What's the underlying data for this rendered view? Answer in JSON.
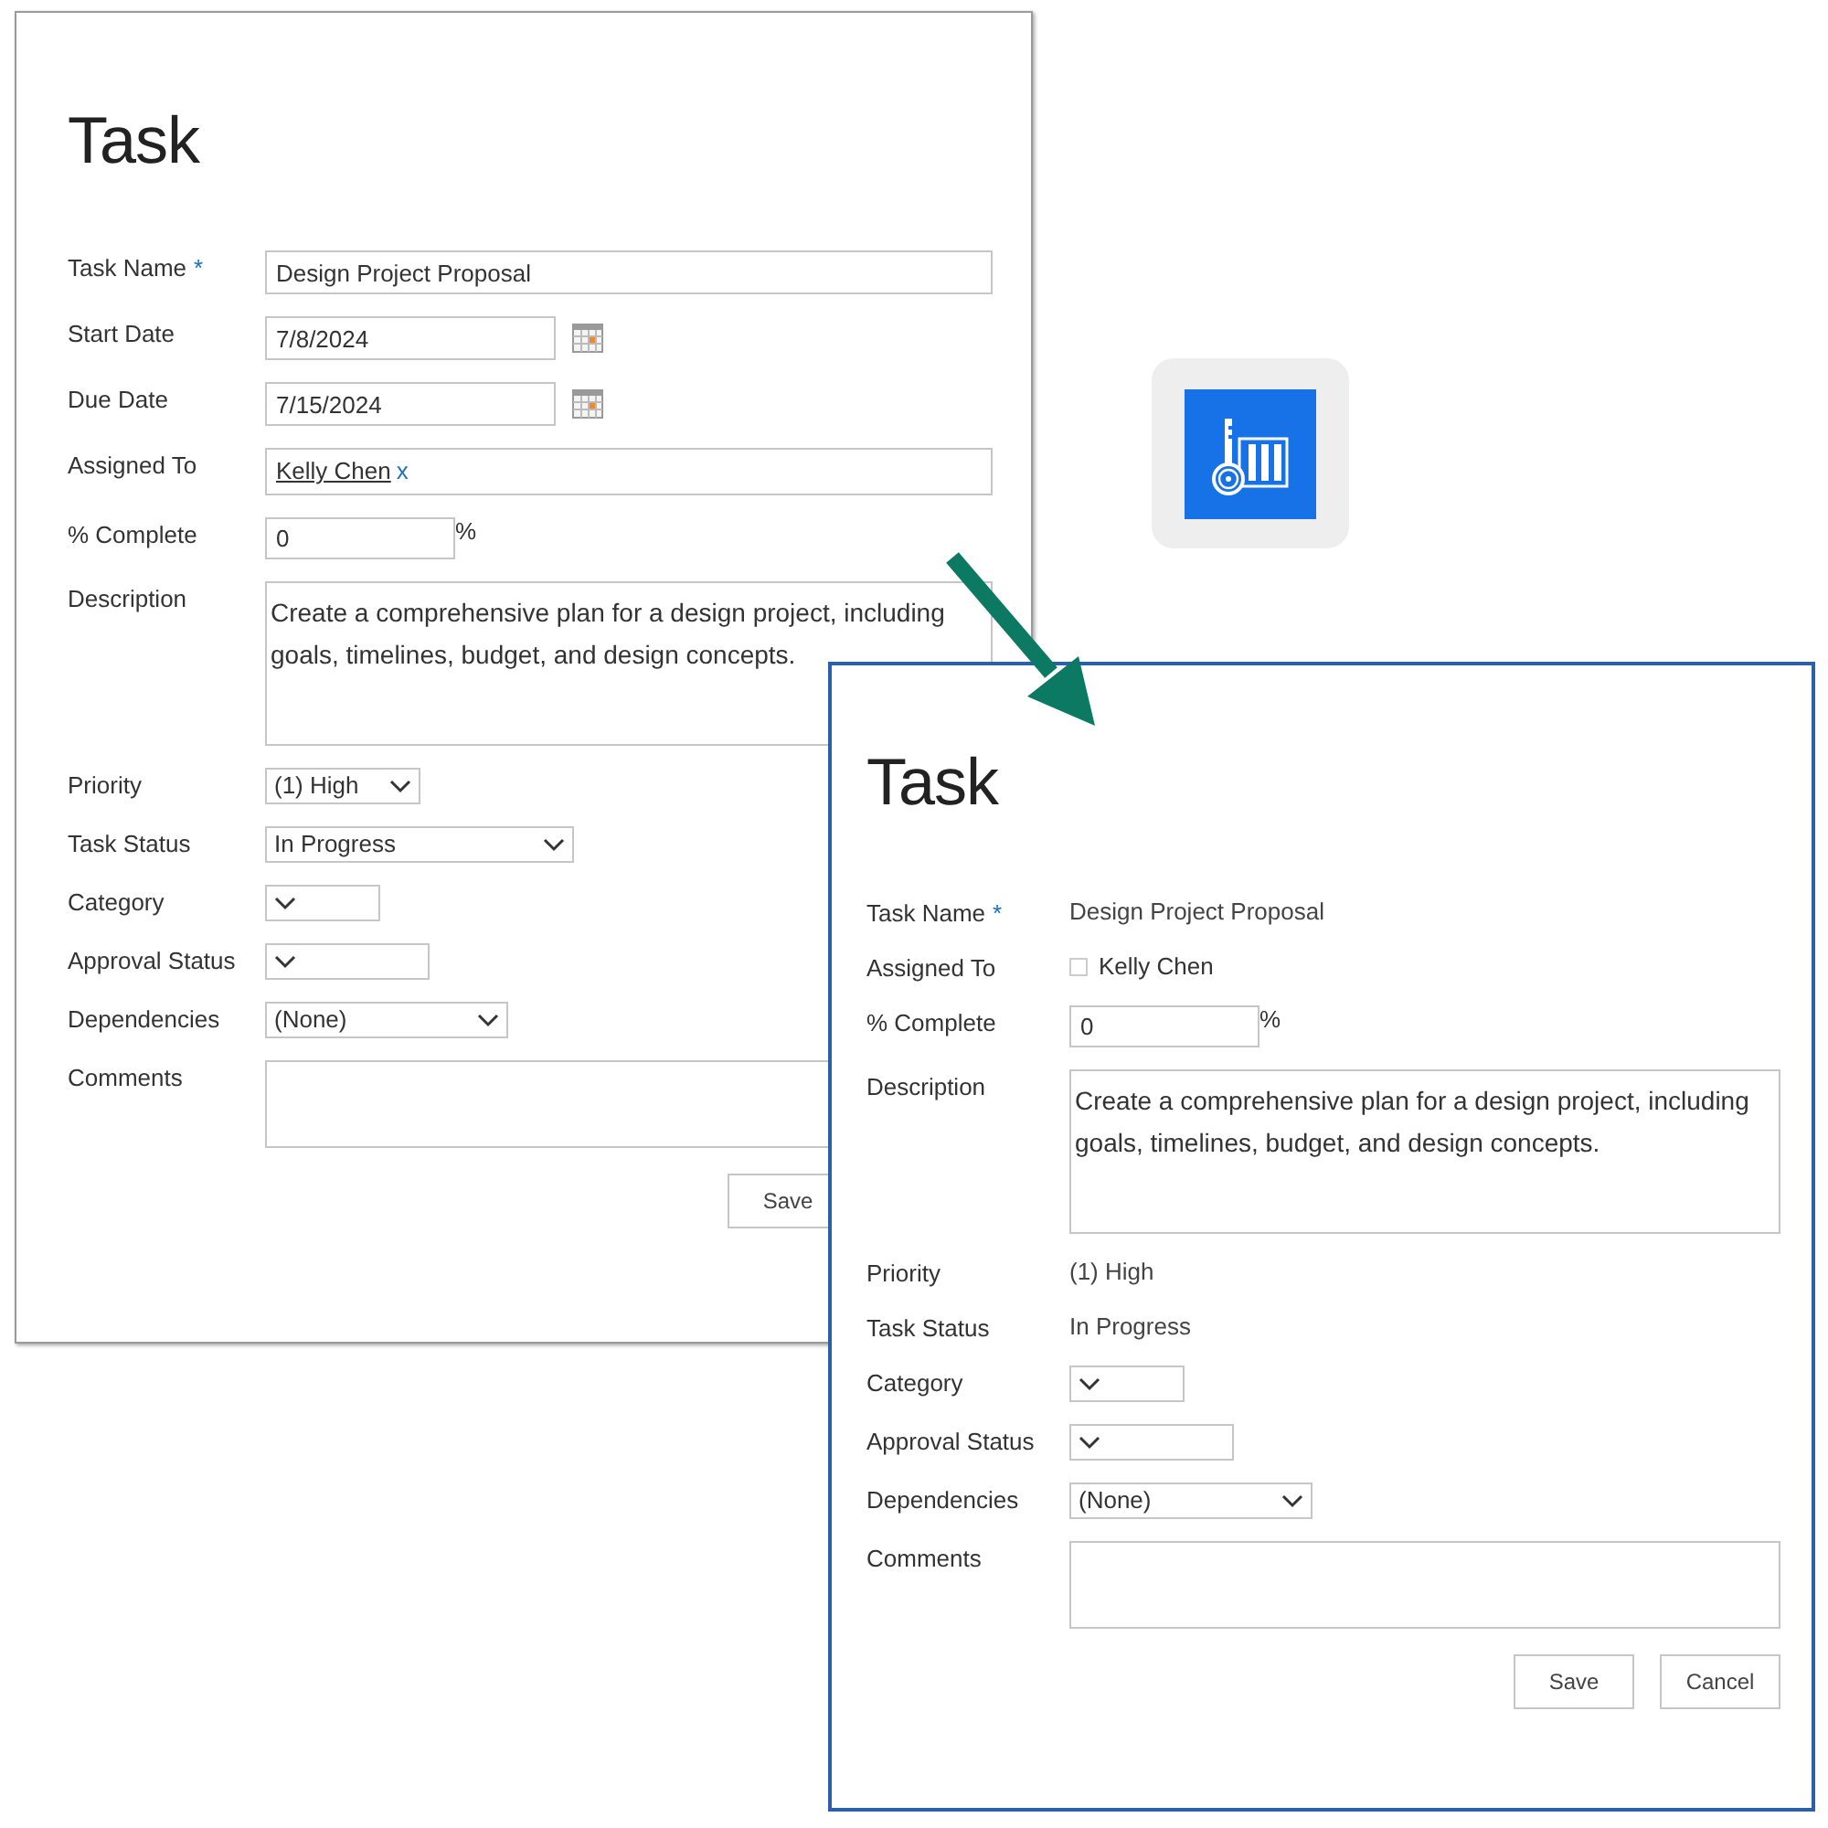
{
  "forms": [
    {
      "title": "Task",
      "fields": [
        {
          "label": "Task Name",
          "required_mark": "*",
          "kind": "text",
          "value": "Design Project Proposal"
        },
        {
          "label": "Start Date",
          "kind": "date",
          "value": "7/8/2024"
        },
        {
          "label": "Due Date",
          "kind": "date",
          "value": "7/15/2024"
        },
        {
          "label": "Assigned To",
          "kind": "people",
          "value": "Kelly Chen",
          "remove": "x"
        },
        {
          "label": "% Complete",
          "kind": "percent",
          "value": "0",
          "suffix": "%"
        },
        {
          "label": "Description",
          "kind": "textarea",
          "value": "Create a comprehensive plan for a design project, including goals, timelines, budget, and design concepts."
        },
        {
          "label": "Priority",
          "kind": "select",
          "value": "(1) High"
        },
        {
          "label": "Task Status",
          "kind": "select",
          "value": "In Progress"
        },
        {
          "label": "Category",
          "kind": "select"
        },
        {
          "label": "Approval Status",
          "kind": "select"
        },
        {
          "label": "Dependencies",
          "kind": "select",
          "value": "(None)"
        },
        {
          "label": "Comments",
          "kind": "memo"
        }
      ],
      "buttons": [
        "Save"
      ]
    },
    {
      "title": "Task",
      "fields": [
        {
          "label": "Task Name",
          "required_mark": "*",
          "kind": "readonly",
          "value": "Design Project Proposal"
        },
        {
          "label": "Assigned To",
          "kind": "person",
          "value": "Kelly Chen"
        },
        {
          "label": "% Complete",
          "kind": "percent",
          "value": "0",
          "suffix": "%"
        },
        {
          "label": "Description",
          "kind": "textarea",
          "value": "Create a comprehensive plan for a design project, including goals, timelines, budget, and design concepts."
        },
        {
          "label": "Priority",
          "kind": "readonly",
          "value": "(1) High"
        },
        {
          "label": "Task Status",
          "kind": "readonly",
          "value": "In Progress"
        },
        {
          "label": "Category",
          "kind": "select"
        },
        {
          "label": "Approval Status",
          "kind": "select"
        },
        {
          "label": "Dependencies",
          "kind": "select",
          "value": "(None)"
        },
        {
          "label": "Comments",
          "kind": "memo"
        }
      ],
      "buttons": [
        "Save",
        "Cancel"
      ]
    }
  ]
}
